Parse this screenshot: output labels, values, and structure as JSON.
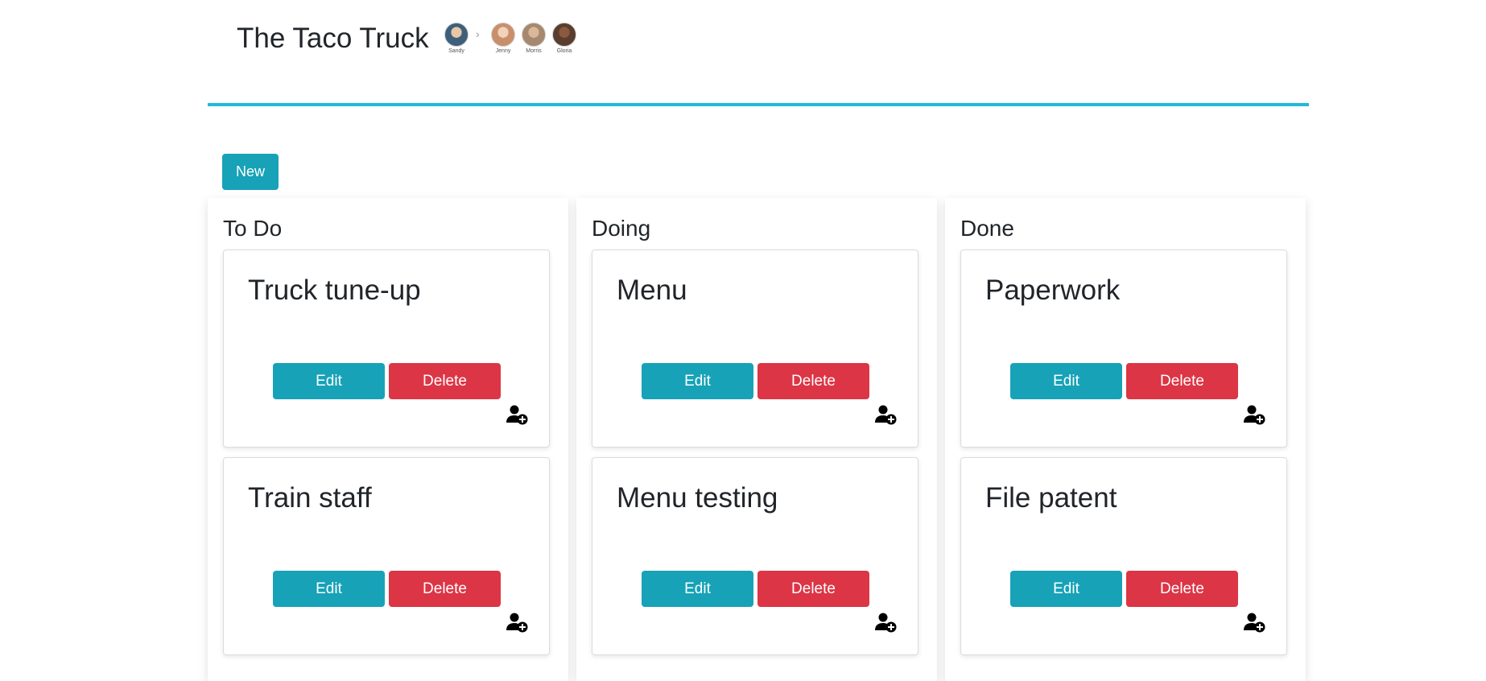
{
  "app": {
    "title": "The Taco Truck"
  },
  "team": {
    "members": [
      {
        "name": "Sandy",
        "icon": "avatar-photo",
        "color": "#3e5f7a"
      },
      {
        "name": "Jenny",
        "icon": "avatar-photo",
        "color": "#c98f6b"
      },
      {
        "name": "Morris",
        "icon": "avatar-photo",
        "color": "#a6886e"
      },
      {
        "name": "Gloria",
        "icon": "avatar-photo",
        "color": "#5a3d2e"
      }
    ],
    "separator": "›"
  },
  "toolbar": {
    "new_label": "New"
  },
  "board": {
    "columns": [
      {
        "title": "To Do",
        "cards": [
          {
            "title": "Truck tune-up",
            "edit_label": "Edit",
            "delete_label": "Delete",
            "icon": "add-user-icon"
          },
          {
            "title": "Train staff",
            "edit_label": "Edit",
            "delete_label": "Delete",
            "icon": "add-user-icon"
          }
        ]
      },
      {
        "title": "Doing",
        "cards": [
          {
            "title": "Menu",
            "edit_label": "Edit",
            "delete_label": "Delete",
            "icon": "add-user-icon"
          },
          {
            "title": "Menu testing",
            "edit_label": "Edit",
            "delete_label": "Delete",
            "icon": "add-user-icon"
          }
        ]
      },
      {
        "title": "Done",
        "cards": [
          {
            "title": "Paperwork",
            "edit_label": "Edit",
            "delete_label": "Delete",
            "icon": "add-user-icon"
          },
          {
            "title": "File patent",
            "edit_label": "Edit",
            "delete_label": "Delete",
            "icon": "add-user-icon"
          }
        ]
      }
    ]
  },
  "colors": {
    "accent": "#1fbad6",
    "primary_button": "#17a2b8",
    "danger_button": "#dc3545"
  }
}
